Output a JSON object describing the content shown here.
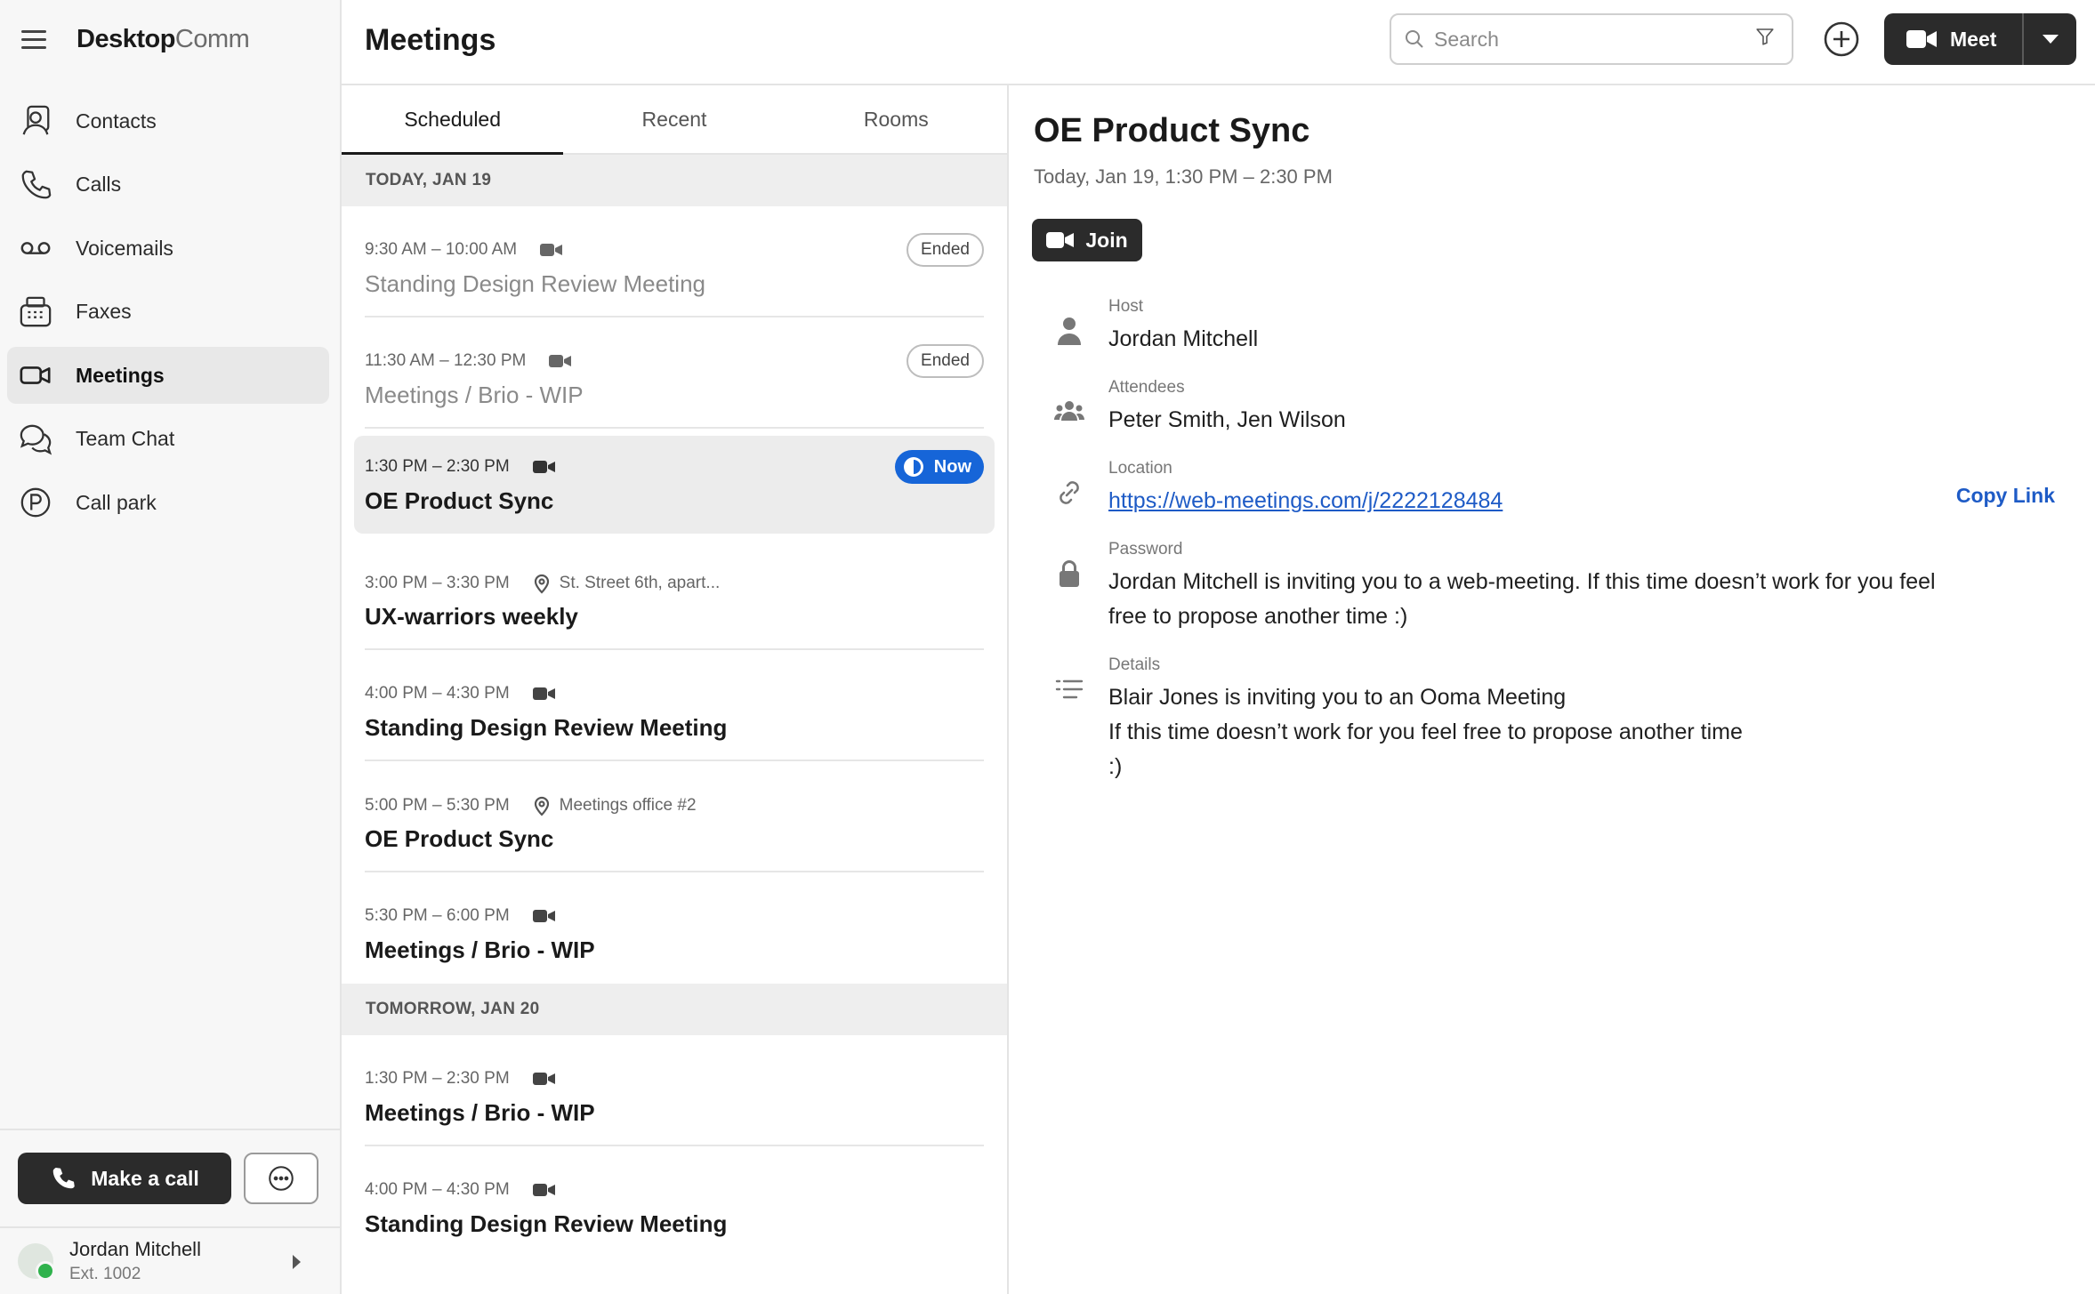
{
  "app": {
    "brand_bold": "Desktop",
    "brand_light": "Comm"
  },
  "sidebar": {
    "items": [
      {
        "label": "Contacts",
        "icon": "contacts-icon"
      },
      {
        "label": "Calls",
        "icon": "phone-icon"
      },
      {
        "label": "Voicemails",
        "icon": "voicemail-icon"
      },
      {
        "label": "Faxes",
        "icon": "fax-icon"
      },
      {
        "label": "Meetings",
        "icon": "video-camera-icon",
        "active": true
      },
      {
        "label": "Team Chat",
        "icon": "chat-icon"
      },
      {
        "label": "Call park",
        "icon": "call-park-icon"
      }
    ],
    "make_call_label": "Make a call",
    "user": {
      "name": "Jordan Mitchell",
      "ext": "Ext. 1002",
      "status_color": "#2fb24c"
    }
  },
  "header": {
    "title": "Meetings",
    "search_placeholder": "Search",
    "meet_label": "Meet"
  },
  "tabs": [
    {
      "label": "Scheduled",
      "active": true
    },
    {
      "label": "Recent"
    },
    {
      "label": "Rooms"
    }
  ],
  "groups": [
    {
      "day": "TODAY, JAN 19",
      "meetings": [
        {
          "time": "9:30 AM – 10:00 AM",
          "type": "video",
          "title": "Standing Design Review Meeting",
          "status": "Ended"
        },
        {
          "time": "11:30 AM – 12:30 PM",
          "type": "video",
          "title": "Meetings / Brio - WIP",
          "status": "Ended"
        },
        {
          "time": "1:30 PM – 2:30 PM",
          "type": "video",
          "title": "OE Product Sync",
          "status": "Now"
        },
        {
          "time": "3:00 PM – 3:30 PM",
          "type": "location",
          "location": "St. Street 6th, apart...",
          "title": "UX-warriors weekly"
        },
        {
          "time": "4:00 PM – 4:30 PM",
          "type": "video",
          "title": "Standing Design Review Meeting"
        },
        {
          "time": "5:00 PM – 5:30 PM",
          "type": "location",
          "location": "Meetings office #2",
          "title": "OE Product Sync"
        },
        {
          "time": "5:30 PM – 6:00 PM",
          "type": "video",
          "title": "Meetings / Brio - WIP"
        }
      ]
    },
    {
      "day": "TOMORROW, JAN 20",
      "meetings": [
        {
          "time": "1:30 PM – 2:30 PM",
          "type": "video",
          "title": "Meetings / Brio - WIP"
        },
        {
          "time": "4:00 PM – 4:30 PM",
          "type": "video",
          "title": "Standing Design Review Meeting"
        }
      ]
    }
  ],
  "detail": {
    "title": "OE Product Sync",
    "datetime": "Today, Jan 19, 1:30 PM – 2:30 PM",
    "join_label": "Join",
    "host_label": "Host",
    "host": "Jordan Mitchell",
    "attendees_label": "Attendees",
    "attendees": "Peter Smith, Jen Wilson",
    "location_label": "Location",
    "location": "https://web-meetings.com/j/2222128484",
    "copy_link_label": "Copy Link",
    "password_label": "Password",
    "password_line1": "Jordan Mitchell is inviting you to a web-meeting. If this time doesn’t work for you feel",
    "password_line2": "free to propose another time :)",
    "details_label": "Details",
    "details_line1": "Blair Jones is inviting you to an Ooma Meeting",
    "details_line2": "If this time doesn’t work for you feel free to propose another time",
    "details_line3": ":)"
  },
  "colors": {
    "accent_blue": "#1665d8",
    "link_blue": "#1e5bc6",
    "dark_button": "#2b2b2b"
  }
}
